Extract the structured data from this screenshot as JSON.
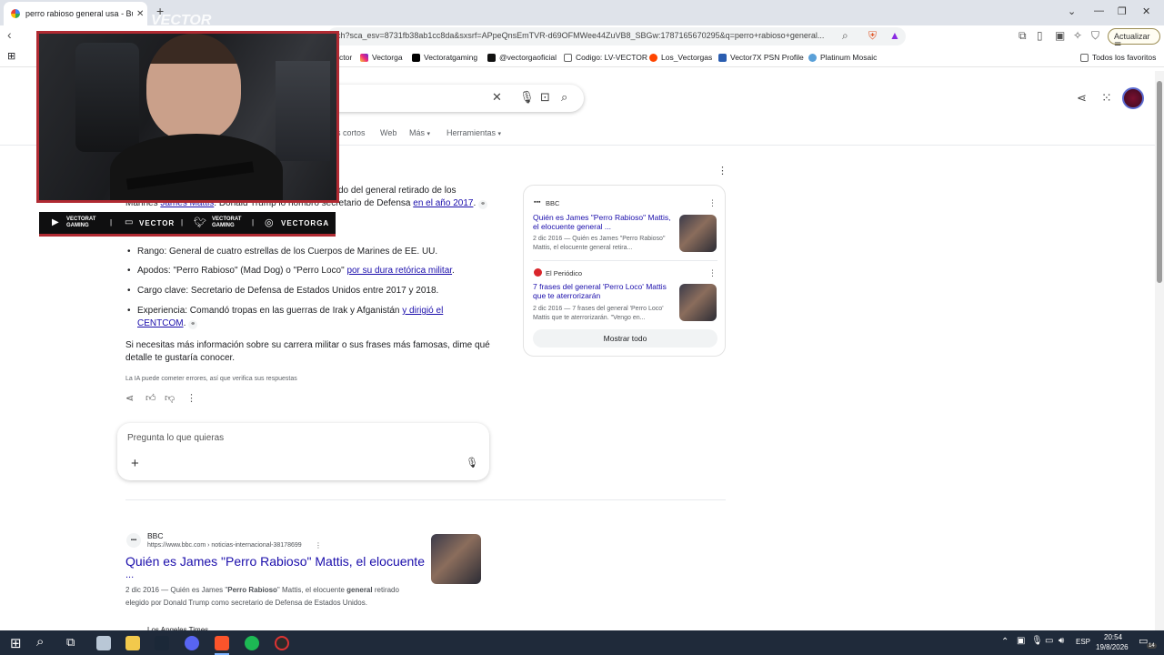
{
  "browser": {
    "tab_title": "perro rabioso general usa - Busca",
    "tab_close": "✕",
    "new_tab": "+",
    "url": "ch?sca_esv=8731fb38ab1cc8da&sxsrf=APpeQnsEmTVR-d69OFMWee44ZuVB8_SBGw:1787165670295&q=perro+rabioso+general...",
    "update_label": "Actualizar",
    "bookmarks": [
      "ctor",
      "Vectorga",
      "Vectoratgaming",
      "@vectorgaoficial",
      "Codigo: LV-VECTOR",
      "Los_Vectorgas",
      "Vector7X PSN Profile",
      "Platinum Mosaic",
      "Todos los favoritos"
    ]
  },
  "search": {
    "nav": [
      "s cortos",
      "Web",
      "Más",
      "Herramientas"
    ],
    "more_dropdown": "▾"
  },
  "ai_overview": {
    "intro_line1": "do del general retirado de los",
    "intro_line2_pre": "Marines ",
    "intro_link1": "James Mattis",
    "intro_line2_mid": ". Donald Trump lo nombró secretario de Defensa ",
    "intro_link2": "en el año 2017",
    "intro_line2_end": ".",
    "bullets": [
      {
        "label": "Rango:",
        "text": " General de cuatro estrellas de los Cuerpos de Marines de EE. UU.",
        "link": ""
      },
      {
        "label": "Apodos:",
        "text": " \"Perro Rabioso\" (Mad Dog) o \"Perro Loco\" ",
        "link": "por su dura retórica militar",
        "end": "."
      },
      {
        "label": "Cargo clave:",
        "text": " Secretario de Defensa de Estados Unidos entre 2017 y 2018.",
        "link": ""
      },
      {
        "label": "Experiencia:",
        "text": " Comandó tropas en las guerras de Irak y Afganistán ",
        "link": "y dirigió el",
        "link2": "CENTCOM",
        "end": "."
      }
    ],
    "closing_line1": "Si necesitas más información sobre su carrera militar o sus frases más famosas, dime qué",
    "closing_line2": "detalle te gustaría conocer.",
    "disclaimer": "La IA puede cometer errores, así que verifica sus respuestas",
    "ask_placeholder": "Pregunta lo que quieras"
  },
  "sources": {
    "items": [
      {
        "site": "BBC",
        "title": "Quién es James \"Perro Rabioso\" Mattis, el elocuente general ...",
        "snippet": "2 dic 2016 — Quién es James \"Perro Rabioso\" Mattis, el elocuente general retira..."
      },
      {
        "site": "El Periódico",
        "title": "7 frases del general 'Perro Loco' Mattis que te aterrorizarán",
        "snippet": "2 dic 2016 — 7 frases del general 'Perro Loco' Mattis que te aterrorizarán. \"Vengo en..."
      }
    ],
    "show_all": "Mostrar todo"
  },
  "result": {
    "site": "BBC",
    "url": "https://www.bbc.com › noticias-internacional-38178699",
    "title": "Quién es James \"Perro Rabioso\" Mattis, el elocuente",
    "title_cont": "...",
    "snippet_line1_a": "2 dic 2016 — Quién es James \"",
    "snippet_line1_b": "Perro Rabioso",
    "snippet_line1_c": "\" Mattis, el elocuente ",
    "snippet_line1_d": "general",
    "snippet_line1_e": " retirado",
    "snippet_line2": "elegido por Donald Trump como secretario de Defensa de Estados Unidos.",
    "next_site": "Los Angeles Times"
  },
  "stream": {
    "labels": [
      "VECTORAT GAMING",
      "VECTOR",
      "VECTORAT GAMING",
      "VECTORGA"
    ],
    "watermark": "VECTOR"
  },
  "taskbar": {
    "lang": "ESP",
    "time": "20:54",
    "date": "19/8/2026",
    "notif": "14"
  },
  "colors": {
    "accent_red": "#b02a32",
    "link_blue": "#1a0dab",
    "taskbar": "#1f2a3a"
  }
}
